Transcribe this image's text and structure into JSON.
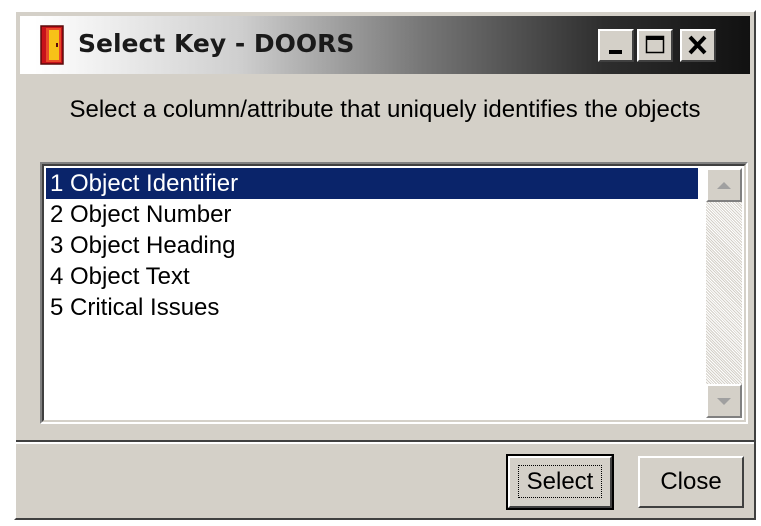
{
  "window": {
    "title": "Select Key - DOORS"
  },
  "prompt": "Select a column/attribute that uniquely identifies the objects",
  "attributes": [
    {
      "label": "1 Object Identifier",
      "selected": true
    },
    {
      "label": "2 Object Number",
      "selected": false
    },
    {
      "label": "3 Object Heading",
      "selected": false
    },
    {
      "label": "4 Object Text",
      "selected": false
    },
    {
      "label": "5 Critical Issues",
      "selected": false
    }
  ],
  "buttons": {
    "select": "Select",
    "close": "Close"
  },
  "colors": {
    "selection": "#0a246a",
    "face": "#d4d0c8",
    "doors_icon": "#c8121a"
  }
}
